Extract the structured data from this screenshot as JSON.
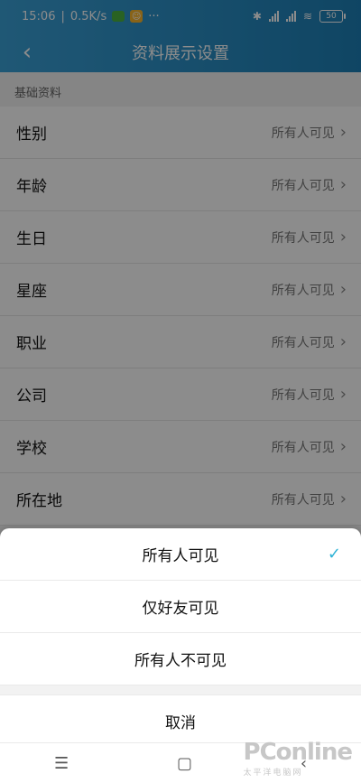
{
  "status_bar": {
    "time": "15:06",
    "speed": "0.5K/s",
    "dots": "···",
    "battery": "50"
  },
  "header": {
    "title": "资料展示设置"
  },
  "section": {
    "title": "基础资料"
  },
  "rows": [
    {
      "label": "性别",
      "value": "所有人可见"
    },
    {
      "label": "年龄",
      "value": "所有人可见"
    },
    {
      "label": "生日",
      "value": "所有人可见"
    },
    {
      "label": "星座",
      "value": "所有人可见"
    },
    {
      "label": "职业",
      "value": "所有人可见"
    },
    {
      "label": "公司",
      "value": "所有人可见"
    },
    {
      "label": "学校",
      "value": "所有人可见"
    },
    {
      "label": "所在地",
      "value": "所有人可见"
    }
  ],
  "sheet": {
    "options": [
      {
        "label": "所有人可见",
        "selected": true
      },
      {
        "label": "仅好友可见",
        "selected": false
      },
      {
        "label": "所有人不可见",
        "selected": false
      }
    ],
    "cancel_label": "取消"
  },
  "watermark": {
    "brand": "PConline",
    "sub": "太平洋电脑网"
  },
  "colors": {
    "header_start": "#3aa0d6",
    "header_end": "#1d7fb6",
    "check": "#2fb3d6"
  }
}
